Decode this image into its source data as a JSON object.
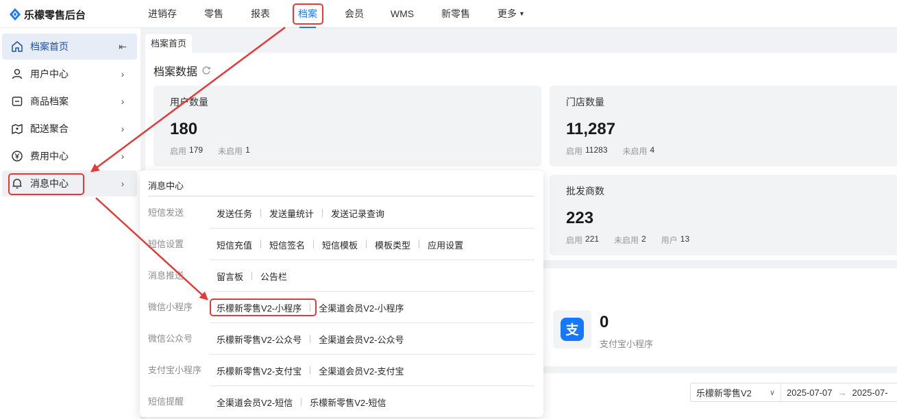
{
  "brand": {
    "name": "乐檬零售后台",
    "color": "#1677ff"
  },
  "nav": {
    "items": [
      {
        "label": "进销存"
      },
      {
        "label": "零售"
      },
      {
        "label": "报表"
      },
      {
        "label": "档案"
      },
      {
        "label": "会员"
      },
      {
        "label": "WMS"
      },
      {
        "label": "新零售"
      },
      {
        "label": "更多"
      }
    ],
    "active": "档案"
  },
  "sidebar": {
    "items": [
      {
        "label": "档案首页",
        "icon": "home-icon"
      },
      {
        "label": "用户中心",
        "icon": "user-icon"
      },
      {
        "label": "商品档案",
        "icon": "product-icon"
      },
      {
        "label": "配送聚合",
        "icon": "delivery-icon"
      },
      {
        "label": "费用中心",
        "icon": "yen-icon"
      },
      {
        "label": "消息中心",
        "icon": "bell-icon"
      }
    ]
  },
  "tabs": [
    {
      "label": "档案首页"
    }
  ],
  "section": {
    "title": "档案数据"
  },
  "cards": [
    {
      "title": "用户数量",
      "value": "180",
      "sub": [
        {
          "label": "启用",
          "value": "179"
        },
        {
          "label": "未启用",
          "value": "1"
        }
      ]
    },
    {
      "title": "门店数量",
      "value": "11,287",
      "sub": [
        {
          "label": "启用",
          "value": "11283"
        },
        {
          "label": "未启用",
          "value": "4"
        }
      ]
    },
    {
      "title": "批发商数",
      "value": "223",
      "sub": [
        {
          "label": "启用",
          "value": "221"
        },
        {
          "label": "未启用",
          "value": "2"
        },
        {
          "label": "用户",
          "value": "13"
        }
      ]
    }
  ],
  "alipay": {
    "value": "0",
    "label": "支付宝小程序",
    "color": "#1677ff"
  },
  "filter": {
    "select": "乐檬新零售V2",
    "date_start": "2025-07-07",
    "date_end": "2025-07-"
  },
  "popup": {
    "title": "消息中心",
    "rows": [
      {
        "label": "短信发送",
        "links": [
          "发送任务",
          "发送量统计",
          "发送记录查询"
        ]
      },
      {
        "label": "短信设置",
        "links": [
          "短信充值",
          "短信签名",
          "短信模板",
          "模板类型",
          "应用设置"
        ]
      },
      {
        "label": "消息推送",
        "links": [
          "留言板",
          "公告栏"
        ]
      },
      {
        "label": "微信小程序",
        "links": [
          "乐檬新零售V2-小程序",
          "全渠道会员V2-小程序"
        ]
      },
      {
        "label": "微信公众号",
        "links": [
          "乐檬新零售V2-公众号",
          "全渠道会员V2-公众号"
        ]
      },
      {
        "label": "支付宝小程序",
        "links": [
          "乐檬新零售V2-支付宝",
          "全渠道会员V2-支付宝"
        ]
      },
      {
        "label": "短信提醒",
        "links": [
          "全渠道会员V2-短信",
          "乐檬新零售V2-短信"
        ]
      }
    ]
  },
  "annotation_color": "#e53935"
}
